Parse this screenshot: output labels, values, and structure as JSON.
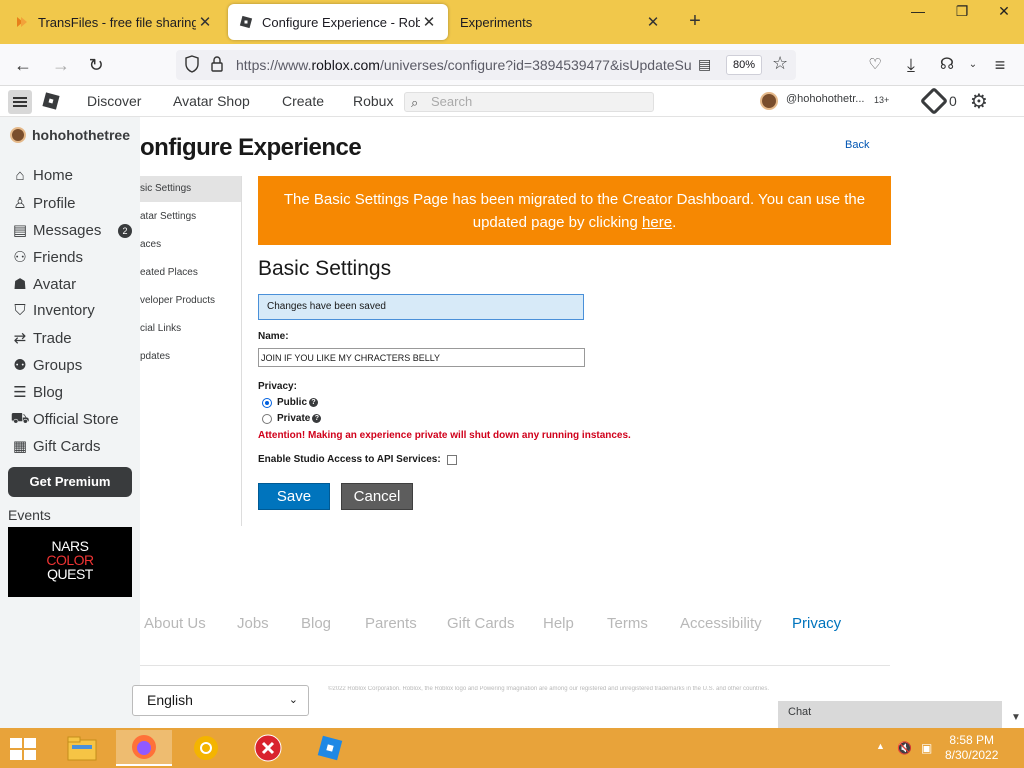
{
  "browser": {
    "tabs": [
      {
        "title": "TransFiles - free file sharing serv",
        "active": false
      },
      {
        "title": "Configure Experience - Roblox",
        "active": true
      },
      {
        "title": "Experiments",
        "active": false
      }
    ],
    "url_prefix": "https://www.",
    "url_domain": "roblox.com",
    "url_suffix": "/universes/configure?id=3894539477&isUpdateSu",
    "zoom": "80%"
  },
  "header": {
    "nav": [
      "Discover",
      "Avatar Shop",
      "Create",
      "Robux"
    ],
    "search_placeholder": "Search",
    "username": "@hohohothetr...",
    "age_badge": "13+",
    "robux": "0"
  },
  "sidebar": {
    "username": "hohohothetree",
    "items": [
      {
        "label": "Home",
        "icon": "home-icon"
      },
      {
        "label": "Profile",
        "icon": "profile-icon"
      },
      {
        "label": "Messages",
        "icon": "messages-icon",
        "badge": "2"
      },
      {
        "label": "Friends",
        "icon": "friends-icon"
      },
      {
        "label": "Avatar",
        "icon": "avatar-icon"
      },
      {
        "label": "Inventory",
        "icon": "inventory-icon"
      },
      {
        "label": "Trade",
        "icon": "trade-icon"
      },
      {
        "label": "Groups",
        "icon": "groups-icon"
      },
      {
        "label": "Blog",
        "icon": "blog-icon"
      },
      {
        "label": "Official Store",
        "icon": "store-icon"
      },
      {
        "label": "Gift Cards",
        "icon": "gift-card-icon"
      }
    ],
    "premium": "Get Premium",
    "events_label": "Events",
    "event_banner": {
      "line1": "NARS",
      "line2": "COLOR",
      "line3": "QUEST"
    }
  },
  "page": {
    "title": "onfigure Experience",
    "back": "Back",
    "subnav": [
      "sic Settings",
      "atar Settings",
      "aces",
      "eated Places",
      "veloper Products",
      "cial Links",
      "pdates"
    ],
    "banner_text": "The Basic Settings Page has been migrated to the Creator Dashboard. You can use the updated page by clicking ",
    "banner_link": "here",
    "banner_end": ".",
    "section_title": "Basic Settings",
    "saved_message": "Changes have been saved",
    "name_label": "Name:",
    "name_value": "JOIN IF YOU LIKE MY CHRACTERS BELLY",
    "privacy_label": "Privacy:",
    "privacy_public": "Public",
    "privacy_private": "Private",
    "privacy_selected": "Public",
    "warning": "Attention! Making an experience private will shut down any running instances.",
    "studio_label": "Enable Studio Access to API Services:",
    "save": "Save",
    "cancel": "Cancel"
  },
  "footer": {
    "links": [
      "About Us",
      "Jobs",
      "Blog",
      "Parents",
      "Gift Cards",
      "Help",
      "Terms",
      "Accessibility",
      "Privacy"
    ],
    "language": "English",
    "copyright": "©2022 Roblox Corporation. Roblox, the Roblox logo and Powering Imagination are among our registered and unregistered trademarks in the U.S. and other countries.",
    "chat": "Chat"
  },
  "taskbar": {
    "time": "8:58 PM",
    "date": "8/30/2022"
  },
  "colors": {
    "tabstrip": "#f1c84b",
    "banner": "#f68802",
    "save": "#0074bd",
    "cancel": "#5d5d5d",
    "warning": "#d0011b",
    "taskbar": "#e8a33a"
  }
}
